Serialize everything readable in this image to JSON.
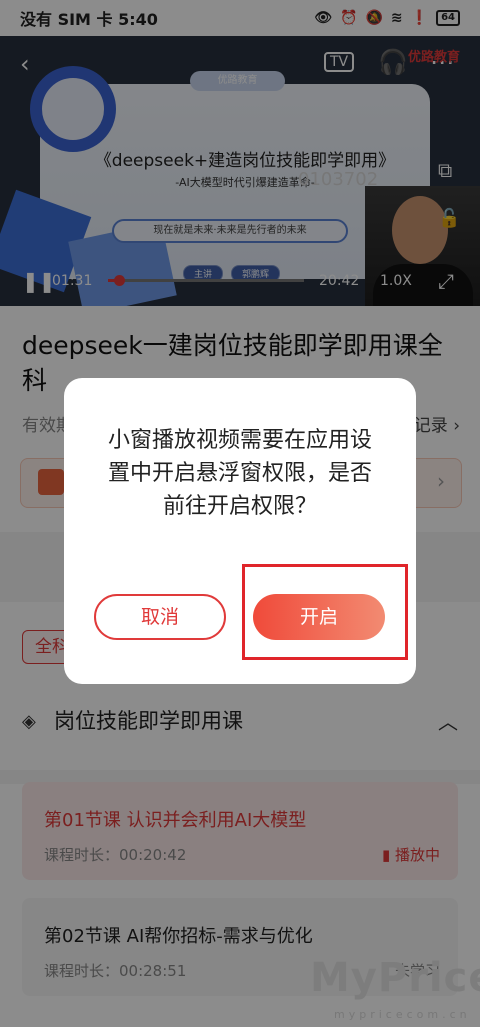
{
  "status_bar": {
    "carrier": "没有 SIM 卡 5:40",
    "battery": "64"
  },
  "video": {
    "brand": "优路教育",
    "slide_logo": "优路教育",
    "slide_title": "《deepseek+建造岗位技能即学即用》",
    "slide_subtitle": "-AI大模型时代引爆建造革命-",
    "slide_number": "0103702",
    "slide_banner": "现在就是未来·未来是先行者的未来",
    "slide_tags": [
      "主讲",
      "郭鹏辉"
    ],
    "current_time": "01:31",
    "total_time": "20:42",
    "speed": "1.0X",
    "progress": 0.074
  },
  "course": {
    "title": "deepseek一建岗位技能即学即用课全科",
    "validity": "有效期",
    "record": "记录"
  },
  "filter_chip": "全科",
  "chapter": {
    "title": "岗位技能即学即用课"
  },
  "lessons": [
    {
      "title": "第01节课 认识并会利用AI大模型",
      "duration": "课程时长：00:20:42",
      "status": "播放中"
    },
    {
      "title": "第02节课 AI帮你招标-需求与优化",
      "duration": "课程时长：00:28:51",
      "status": "未学习"
    }
  ],
  "watermark": {
    "main": "MyPrice",
    "sub": "mypricecom.cn"
  },
  "dialog": {
    "message": "小窗播放视频需要在应用设置中开启悬浮窗权限，是否前往开启权限？",
    "cancel_label": "取消",
    "open_label": "开启"
  }
}
